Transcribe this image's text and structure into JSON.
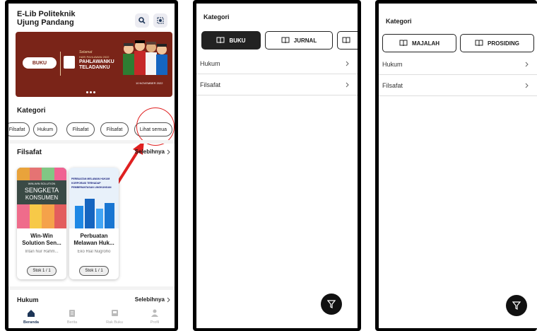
{
  "screen1": {
    "app_title_line1": "E-Lib Politeknik",
    "app_title_line2": "Ujung Pandang",
    "banner": {
      "logo_text": "BUKU",
      "greeting": "Selamat",
      "event_small": "HARI PAHLAWAN 2022",
      "headline1": "PAHLAWANKU",
      "headline2": "TELADANKU",
      "date": "10 NOVEMBER 2022"
    },
    "kategori_title": "Kategori",
    "chips": [
      "Filsafat",
      "Hukum",
      "Filsafat",
      "Filsafat"
    ],
    "lihat_semua": "Lihat semua",
    "filsafat_section": {
      "title": "Filsafat",
      "more": "Selebihnya"
    },
    "books": [
      {
        "title": "Win-Win Solution Sen...",
        "author": "Intan Nur Rahm...",
        "stok": "Stok 1 / 1",
        "cover_top": "WIN-WIN SOLUTION",
        "cover_line1": "SENGKETA",
        "cover_line2": "KONSUMEN"
      },
      {
        "title": "Perbuatan Melawan Huk...",
        "author": "Eko Rial Nugroho",
        "stok": "Stok 1 / 1",
        "cover_line1": "PERBUATAN MELAWAN HUKUM",
        "cover_line2": "KORPORASI TERHADAP",
        "cover_line3": "PEMBERANTASAN LINGKUNGAN"
      }
    ],
    "hukum_section": {
      "title": "Hukum",
      "more": "Selebihnya"
    },
    "nav": [
      "Beranda",
      "Berita",
      "Rak Buku",
      "Profil"
    ],
    "colors": {
      "banner": "#7a2418",
      "annotation": "#e02020",
      "active_nav": "#1d3557"
    }
  },
  "screen2": {
    "title": "Kategori",
    "tabs": [
      "BUKU",
      "JURNAL"
    ],
    "rows": [
      "Hukum",
      "Filsafat"
    ]
  },
  "screen3": {
    "title": "Kategori",
    "tabs": [
      "MAJALAH",
      "PROSIDING"
    ],
    "rows": [
      "Hukum",
      "Filsafat"
    ]
  }
}
